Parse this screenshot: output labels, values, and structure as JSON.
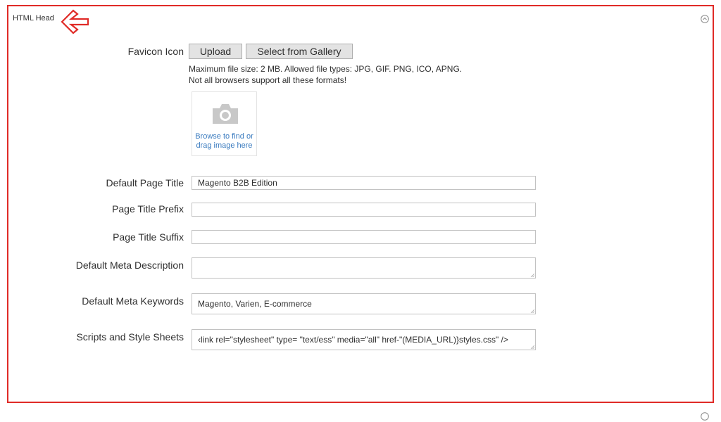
{
  "section": {
    "title": "HTML Head",
    "collapse_icon": "chevron-up-circle-icon",
    "annotation_icon": "arrow-left-icon"
  },
  "favicon": {
    "label": "Favicon Icon",
    "upload_label": "Upload",
    "gallery_label": "Select from Gallery",
    "note_line1": "Maximum file size: 2 MB. Allowed file types: JPG, GIF. PNG, ICO, APNG.",
    "note_line2": "Not all browsers support all these formats!",
    "dropzone_icon": "camera-icon",
    "dropzone_text_line1": "Browse to find or",
    "dropzone_text_line2": "drag image here"
  },
  "fields": {
    "default_page_title": {
      "label": "Default Page Title",
      "value": "Magento B2B Edition"
    },
    "page_title_prefix": {
      "label": "Page Title Prefix",
      "value": ""
    },
    "page_title_suffix": {
      "label": "Page Title Suffix",
      "value": ""
    },
    "default_meta_description": {
      "label": "Default Meta Description",
      "value": ""
    },
    "default_meta_keywords": {
      "label": "Default Meta Keywords",
      "value": "Magento, Varien, E-commerce"
    },
    "scripts_and_style_sheets": {
      "label": "Scripts and Style Sheets",
      "value": "‹link rel=\"stylesheet\" type= \"text/ess\" media=\"all\" href-\"(MEDIA_URL)}styles.css\" />"
    }
  },
  "colors": {
    "highlight_border": "#e02b27",
    "link": "#3a7bbf"
  }
}
